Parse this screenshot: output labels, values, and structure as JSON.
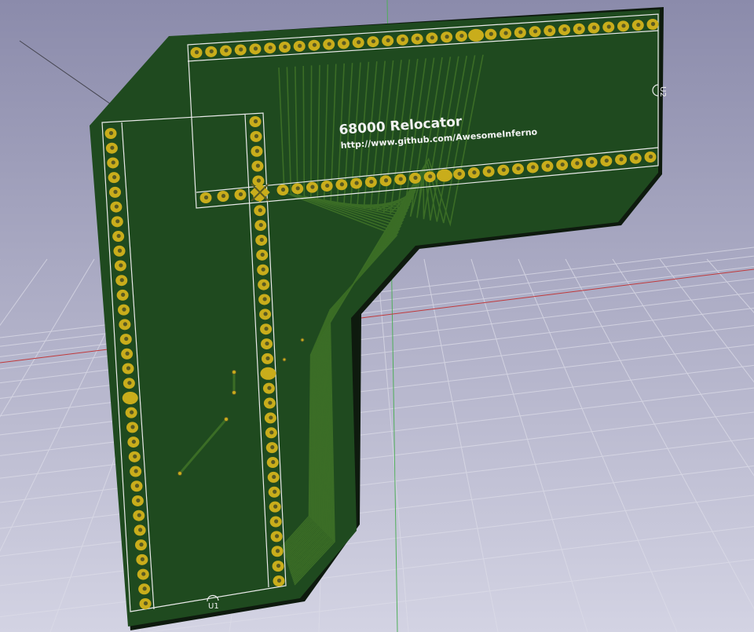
{
  "viewer": {
    "background_top": "#8f8fae",
    "background_bottom": "#cdcde0",
    "grid_color": "#d9d9e6",
    "x_axis_color": "#c0393b",
    "y_axis_color": "#4fae5a"
  },
  "board": {
    "substrate_color": "#1f4a1f",
    "edge_color": "#0e1a0e",
    "trace_color": "#3b6f27",
    "silk_color": "#f2f2f2",
    "pad_color": "#c9ad1b",
    "hole_color": "#5a5a22"
  },
  "silkscreen": {
    "title": "68000 Relocator",
    "url": "http://www.github.com/AwesomeInferno"
  },
  "components": {
    "u1_ref": "U1",
    "u2_ref": "U2"
  },
  "icons": {
    "fiducial": "crosshair-pad-icon",
    "pin1_marker": "pin-one-marker-icon"
  }
}
